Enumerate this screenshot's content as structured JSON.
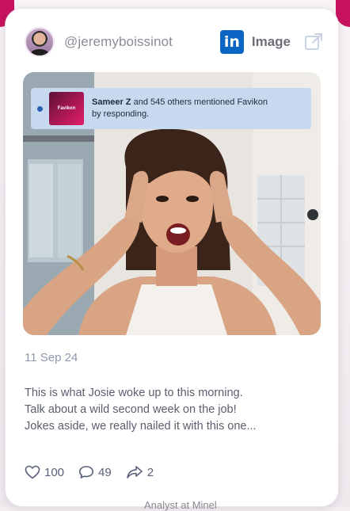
{
  "post": {
    "handle": "@jeremyboissinot",
    "network_label": "in",
    "type_label": "Image",
    "date": "11 Sep 24",
    "caption_lines": [
      "This is what Josie woke up to this morning.",
      "Talk about a wild second week on the job!",
      "Jokes aside, we really nailed it with this one..."
    ],
    "stats": {
      "likes": "100",
      "comments": "49",
      "shares": "2"
    }
  },
  "notification": {
    "thumb_label": "Favikon",
    "name": "Sameer Z",
    "rest_line1": " and 545 others mentioned Favikon",
    "line2": "by responding."
  },
  "footer_partial_text": "Analyst at Minel",
  "colors": {
    "accent_pink": "#c8125e",
    "linkedin_blue": "#0a66c2",
    "notification_bg": "#c7d9ee"
  },
  "icons": {
    "external": "external-link-icon",
    "like": "heart-icon",
    "comment": "comment-icon",
    "share": "share-icon"
  }
}
